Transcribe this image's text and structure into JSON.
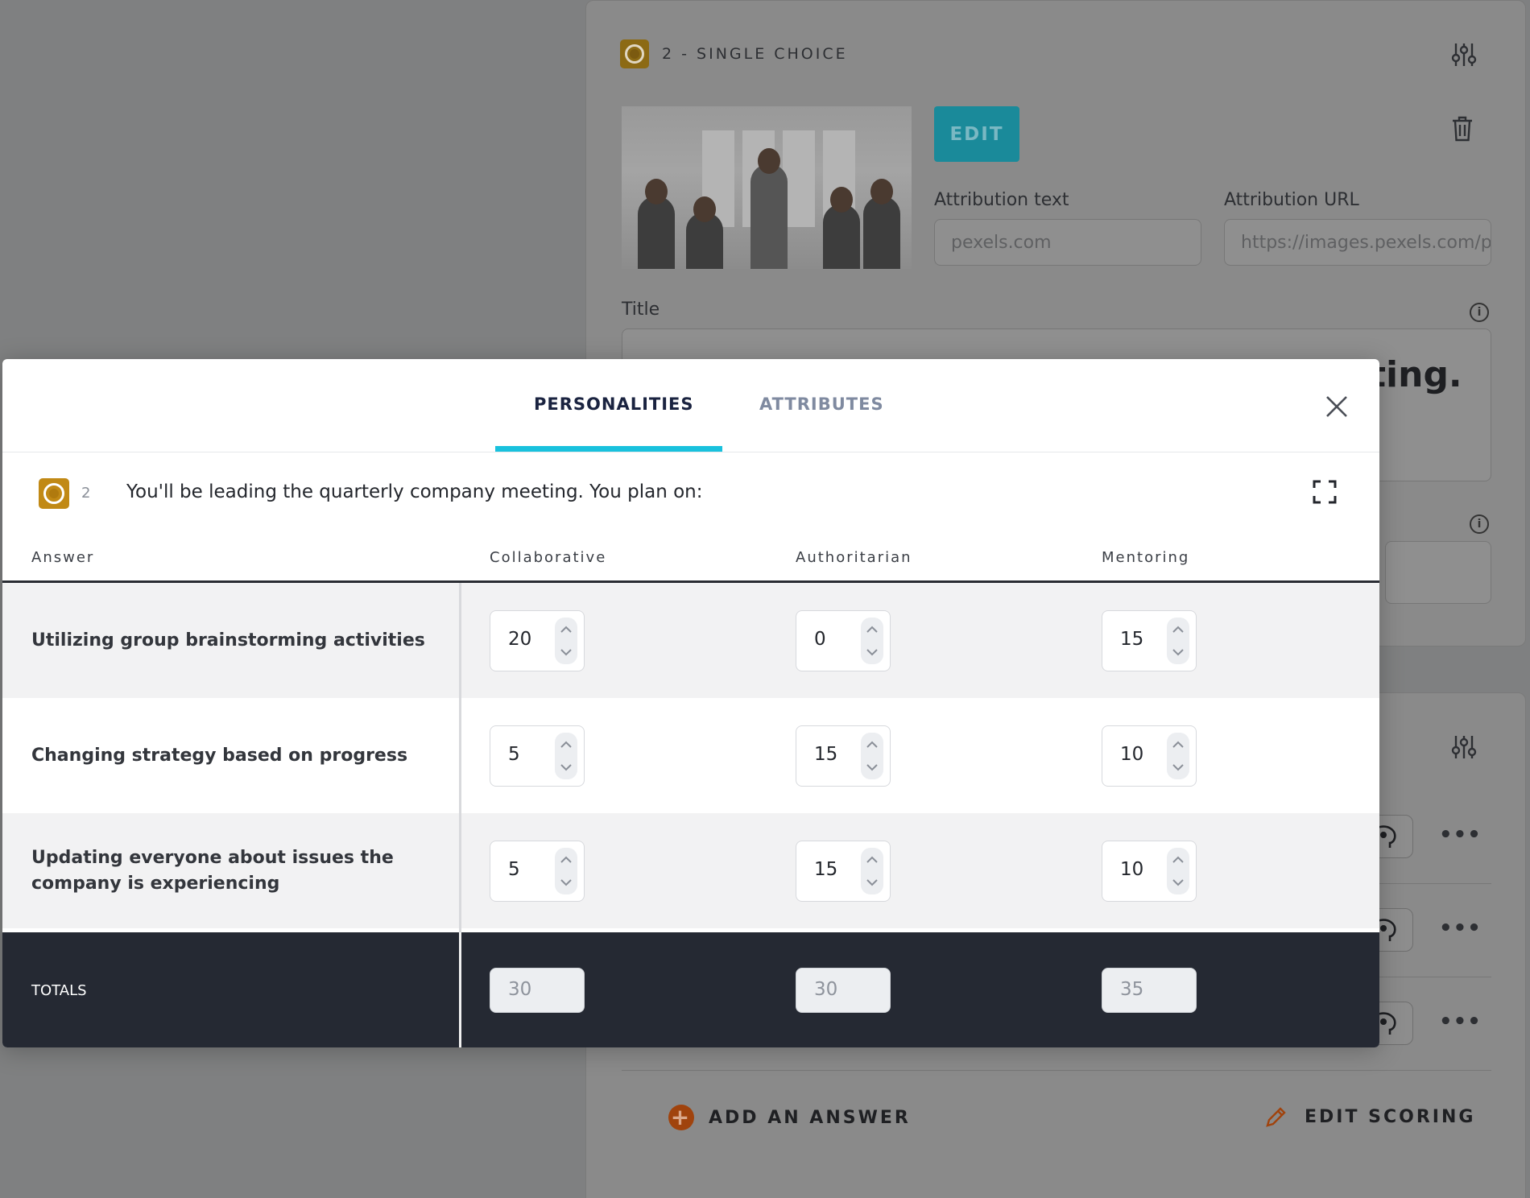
{
  "background": {
    "question_type_label": "2 - SINGLE CHOICE",
    "edit_button": "EDIT",
    "attribution_text_label": "Attribution text",
    "attribution_text_value": "pexels.com",
    "attribution_url_label": "Attribution URL",
    "attribution_url_value": "https://images.pexels.com/p",
    "title_label": "Title",
    "title_fragment": "ting.",
    "add_answer_label": "ADD AN ANSWER",
    "edit_scoring_label": "EDIT SCORING",
    "more_dots": "•••"
  },
  "modal": {
    "tabs": [
      {
        "label": "PERSONALITIES",
        "active": true
      },
      {
        "label": "ATTRIBUTES",
        "active": false
      }
    ],
    "question_number": "2",
    "question_text": "You'll be leading the quarterly company meeting. You plan on:",
    "columns": [
      "Answer",
      "Collaborative",
      "Authoritarian",
      "Mentoring"
    ],
    "rows": [
      {
        "answer": "Utilizing group brainstorming activities",
        "values": [
          "20",
          "0",
          "15"
        ]
      },
      {
        "answer": "Changing strategy based on progress",
        "values": [
          "5",
          "15",
          "10"
        ]
      },
      {
        "answer": "Updating everyone about issues the company is experiencing",
        "values": [
          "5",
          "15",
          "10"
        ]
      }
    ],
    "totals_label": "TOTALS",
    "totals": [
      "30",
      "30",
      "35"
    ]
  },
  "colors": {
    "accent_cyan": "#19c1dd",
    "question_icon": "#c18915",
    "totals_bg": "#252933",
    "edit_button": "#1a8a9a"
  },
  "icons": {
    "question_type": "radio-circle-icon",
    "settings": "sliders-icon",
    "delete": "trash-icon",
    "info": "info-icon",
    "close": "close-icon",
    "expand": "expand-icon",
    "add": "plus-circle-icon",
    "edit_scoring": "pencil-icon",
    "personality": "brain-gear-icon"
  }
}
